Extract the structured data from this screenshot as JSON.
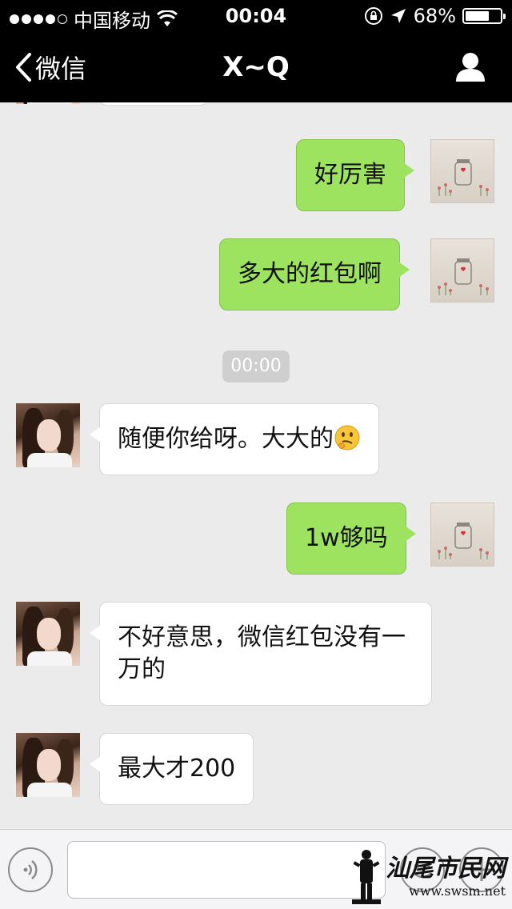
{
  "status_bar": {
    "carrier": "中国移动",
    "time": "00:04",
    "battery_percent": "68%",
    "battery_level": 0.68,
    "signal_bars_filled": 4,
    "signal_bars_total": 5
  },
  "nav": {
    "back_label": "微信",
    "title": "X~Q",
    "profile_icon": "person-icon"
  },
  "messages": [
    {
      "direction": "out",
      "text": "好厉害"
    },
    {
      "direction": "out",
      "text": "多大的红包啊"
    },
    {
      "direction": "timestamp",
      "text": "00:00"
    },
    {
      "direction": "in",
      "text": "随便你给呀。大大的",
      "emoji": "thinking-face"
    },
    {
      "direction": "out",
      "text": "1w够吗"
    },
    {
      "direction": "in",
      "text": "不好意思，微信红包没有一万的"
    },
    {
      "direction": "in",
      "text": "最大才200"
    }
  ],
  "input_bar": {
    "voice_icon": "voice-icon",
    "text_value": "",
    "emoji_icon": "smiley-icon",
    "plus_icon": "plus-icon"
  },
  "watermark": {
    "brand": "汕尾市民网",
    "site": "www.swsm.net"
  },
  "colors": {
    "nav_background": "#000000",
    "chat_background": "#ebebeb",
    "outgoing_bubble": "#9ee35f",
    "incoming_bubble": "#ffffff",
    "timestamp_chip": "#cfcfcf"
  }
}
